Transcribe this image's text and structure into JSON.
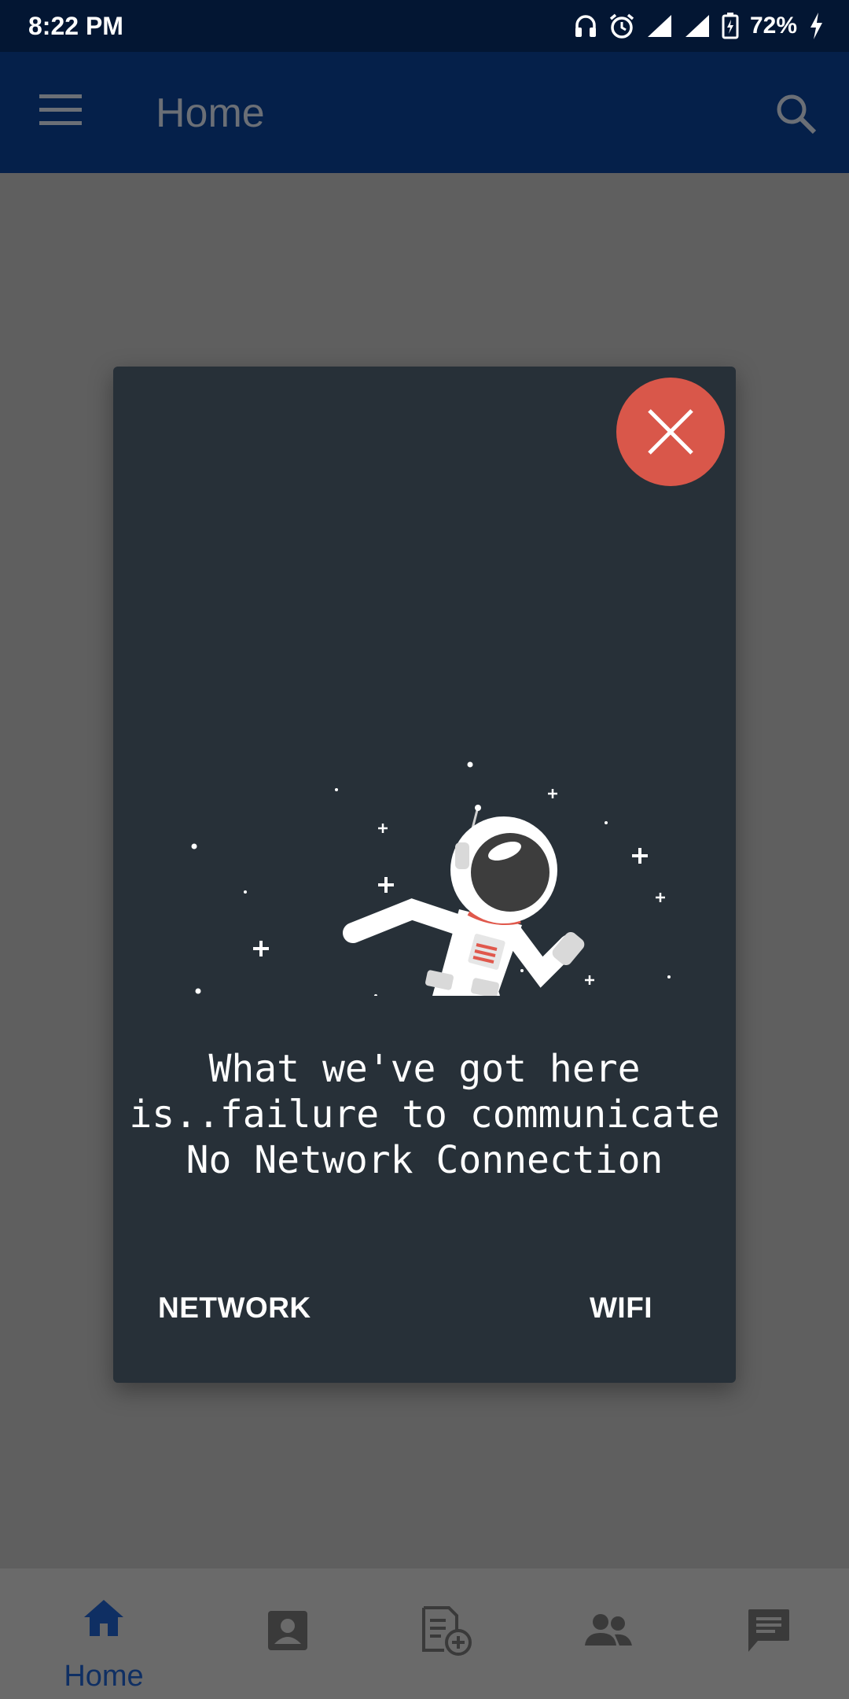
{
  "status_bar": {
    "time": "8:22 PM",
    "battery": "72%"
  },
  "app_bar": {
    "title": "Home"
  },
  "dialog": {
    "message": "What we've got here is..failure to communicate   No Network Connection",
    "network_button": "NETWORK",
    "wifi_button": "WIFI"
  },
  "bottom_nav": {
    "items": [
      {
        "label": "Home",
        "icon": "home-icon"
      },
      {
        "icon": "contact-icon"
      },
      {
        "icon": "note-add-icon"
      },
      {
        "icon": "people-icon"
      },
      {
        "icon": "chat-icon"
      }
    ]
  },
  "colors": {
    "status_bar": "#031633",
    "app_bar": "#05204a",
    "dialog_bg": "#273038",
    "close_button": "#d9574a",
    "nav_active": "#0f2f63"
  }
}
